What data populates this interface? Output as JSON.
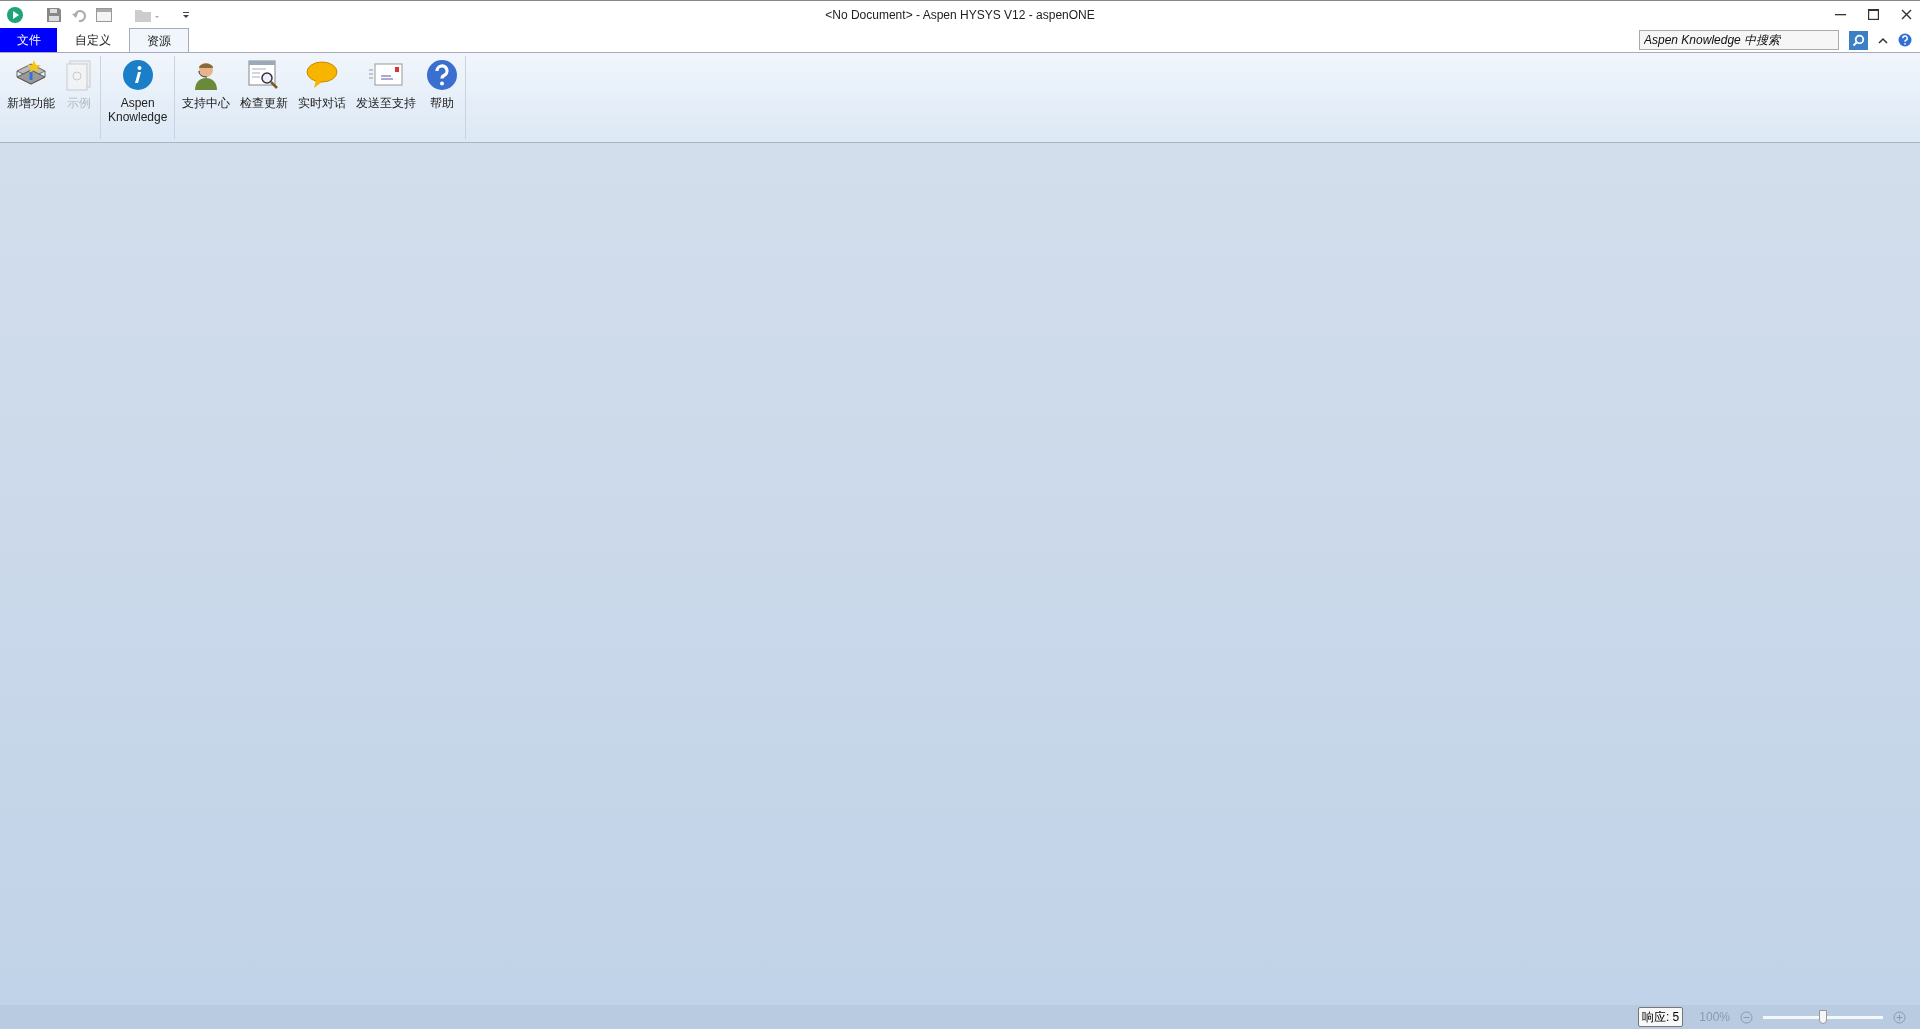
{
  "window": {
    "title": "<No Document> - Aspen HYSYS V12 - aspenONE"
  },
  "tabs": [
    {
      "label": "文件",
      "kind": "file",
      "selected": false
    },
    {
      "label": "自定义",
      "kind": "tab",
      "selected": false
    },
    {
      "label": "资源",
      "kind": "tab",
      "selected": true
    }
  ],
  "search": {
    "placeholder": "Aspen Knowledge 中搜索"
  },
  "ribbon": {
    "groups": [
      {
        "buttons": [
          {
            "label": "新增功能",
            "disabled": false
          },
          {
            "label": "示例",
            "disabled": true
          }
        ]
      },
      {
        "buttons": [
          {
            "label": "Aspen\nKnowledge",
            "disabled": false
          }
        ]
      },
      {
        "buttons": [
          {
            "label": "支持中心",
            "disabled": false
          },
          {
            "label": "检查更新",
            "disabled": false
          },
          {
            "label": "实时对话",
            "disabled": false
          },
          {
            "label": "发送至支持",
            "disabled": false
          },
          {
            "label": "帮助",
            "disabled": false
          }
        ]
      }
    ]
  },
  "status_bar": {
    "response": "响应: 5",
    "zoom_text": "100%",
    "zoom": {
      "level": 0.5
    }
  }
}
